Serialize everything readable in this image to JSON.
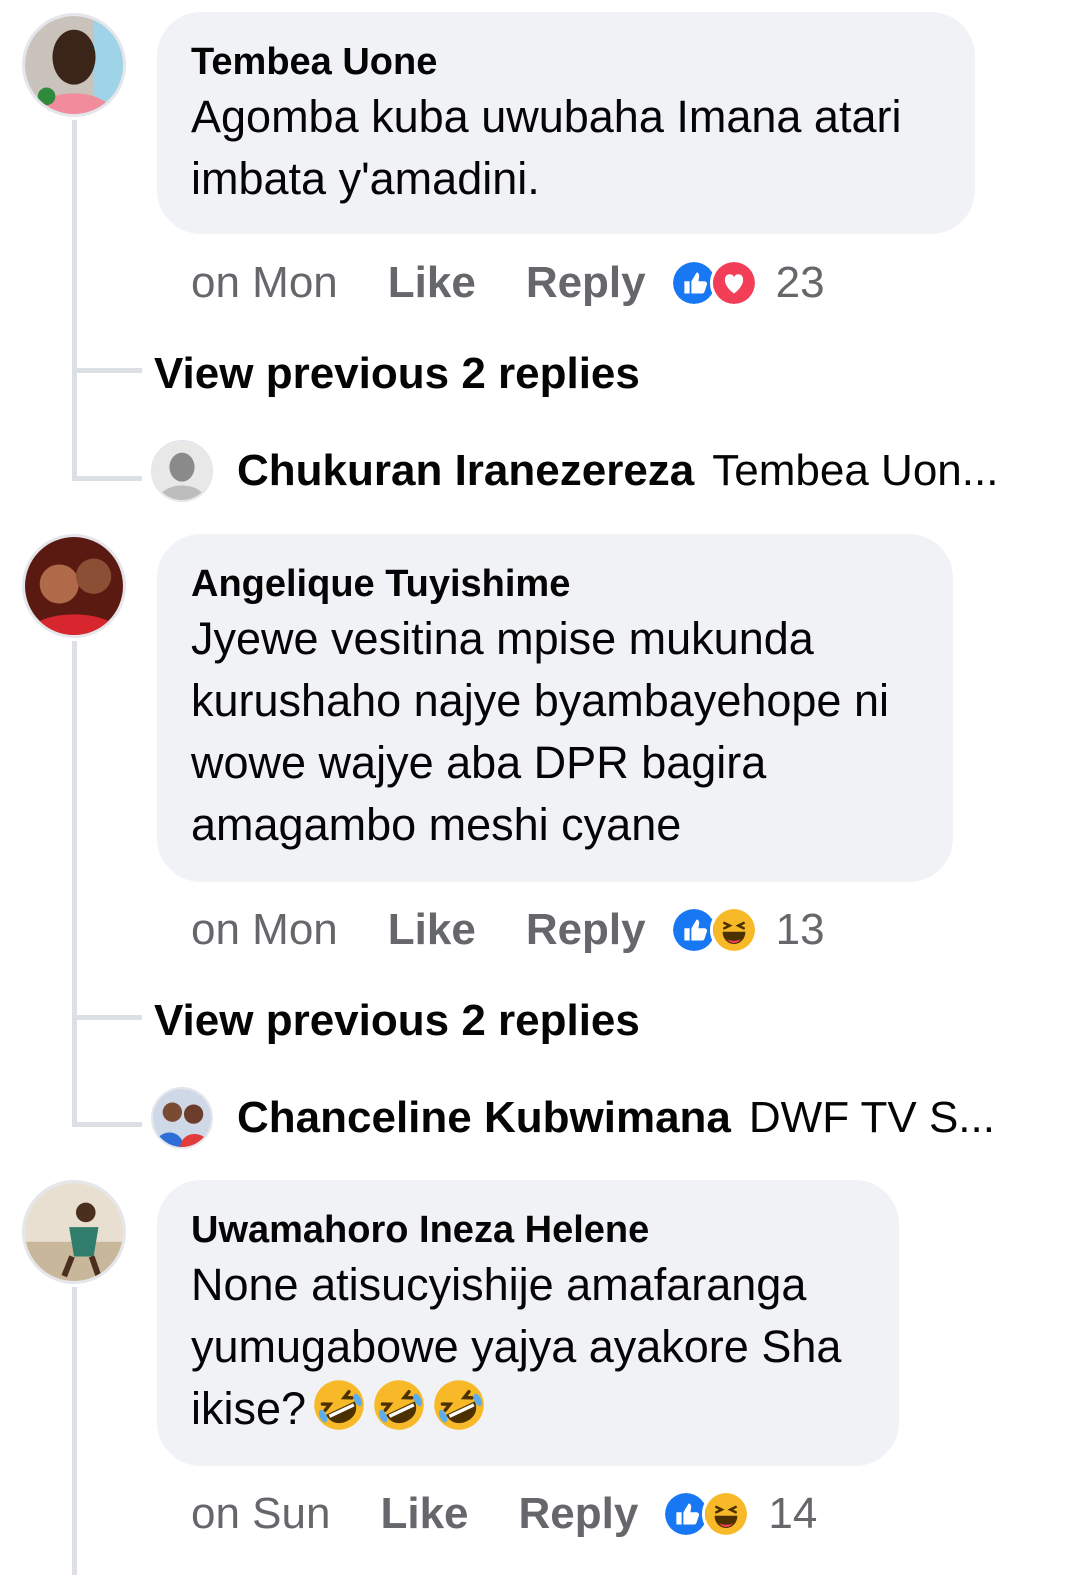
{
  "comments": [
    {
      "author": "Tembea Uone",
      "text_lines": [
        "Agomba kuba uwubaha Imana atari",
        "imbata y'amadini."
      ],
      "time": "on Mon",
      "like_label": "Like",
      "reply_label": "Reply",
      "reactions": [
        "like-icon",
        "love-icon"
      ],
      "reaction_count": "23",
      "view_previous": "View previous 2 replies",
      "latest_reply": {
        "author": "Chukuran Iranezereza",
        "text": "Tembea Uon..."
      }
    },
    {
      "author": "Angelique Tuyishime",
      "text_lines": [
        "Jyewe vesitina mpise mukunda",
        "kurushaho najye byambayehope ni",
        "wowe wajye aba DPR bagira",
        "amagambo meshi cyane"
      ],
      "time": "on Mon",
      "like_label": "Like",
      "reply_label": "Reply",
      "reactions": [
        "like-icon",
        "haha-icon"
      ],
      "reaction_count": "13",
      "view_previous": "View previous 2 replies",
      "latest_reply": {
        "author": "Chanceline Kubwimana",
        "text": "DWF TV S..."
      }
    },
    {
      "author": "Uwamahoro Ineza Helene",
      "text_lines": [
        "None atisucyishije amafaranga",
        "yumugabowe yajya ayakore Sha",
        "ikise?"
      ],
      "text_emojis": [
        "rofl-emoji",
        "rofl-emoji",
        "rofl-emoji"
      ],
      "time": "on Sun",
      "like_label": "Like",
      "reply_label": "Reply",
      "reactions": [
        "like-icon",
        "haha-icon"
      ],
      "reaction_count": "14"
    }
  ],
  "colors": {
    "bubble": "#f0f2f5",
    "meta_text": "#65676b",
    "like_blue": "#1877f2",
    "love_red": "#f33e58",
    "haha_yellow": "#f7b928"
  }
}
